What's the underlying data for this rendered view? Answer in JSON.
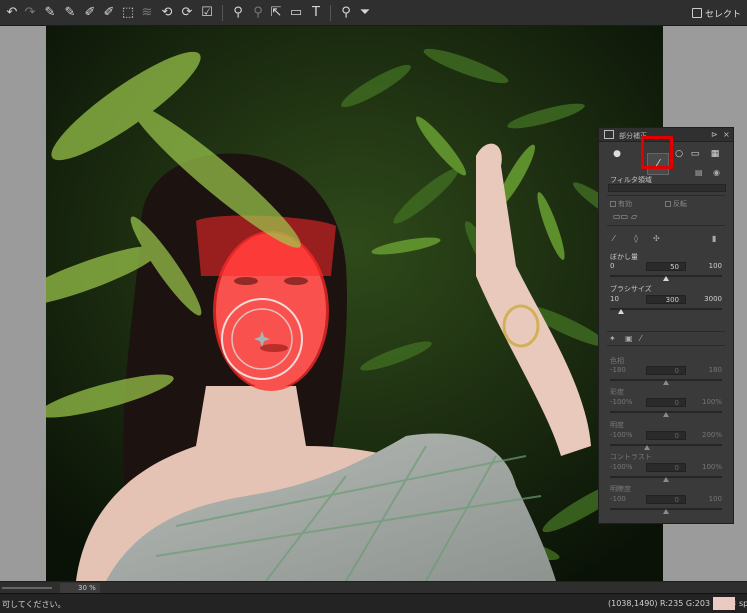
{
  "toolbar": {
    "icons": [
      "undo-icon",
      "redo-icon",
      "auto-adjust-icon",
      "auto-adjust-alt-icon",
      "brush-adjust-icon",
      "brush-adjust-alt-icon",
      "crop-icon",
      "layers-icon",
      "rotate-left-icon",
      "rotate-right-icon",
      "check-icon",
      "stamp-icon",
      "retouch-icon",
      "export-icon",
      "screen-icon",
      "text-icon",
      "search-icon",
      "filter-icon"
    ],
    "select_label": "セレクト"
  },
  "panel": {
    "title": "部分補正",
    "filter_area_label": "フィルタ領域",
    "enabled_label": "有効",
    "invert_label": "反転",
    "blur": {
      "label": "ぼかし量",
      "min": "0",
      "value": "50",
      "max": "100",
      "fraction": 0.5
    },
    "brush_size": {
      "label": "ブラシサイズ",
      "min": "10",
      "value": "300",
      "max": "3000",
      "fraction": 0.1
    },
    "adjustments": [
      {
        "label": "色相",
        "min": "-180",
        "value": "0",
        "max": "180",
        "fraction": 0.5
      },
      {
        "label": "彩度",
        "min": "-100%",
        "value": "0",
        "max": "100%",
        "fraction": 0.5
      },
      {
        "label": "明度",
        "min": "-100%",
        "value": "0",
        "max": "200%",
        "fraction": 0.333
      },
      {
        "label": "コントラスト",
        "min": "-100%",
        "value": "0",
        "max": "100%",
        "fraction": 0.5
      },
      {
        "label": "明瞭度",
        "min": "-100",
        "value": "0",
        "max": "100",
        "fraction": 0.5
      }
    ]
  },
  "zoom": {
    "value": "30",
    "unit": "%"
  },
  "status": {
    "message": "可してください。",
    "info": "(1038,1490) R:235 G:203 B:193",
    "swatch_color": "#ebcbc1",
    "trailing": "sp"
  },
  "colors": {
    "mask": "#ff2a2a",
    "highlight": "#e00000"
  }
}
